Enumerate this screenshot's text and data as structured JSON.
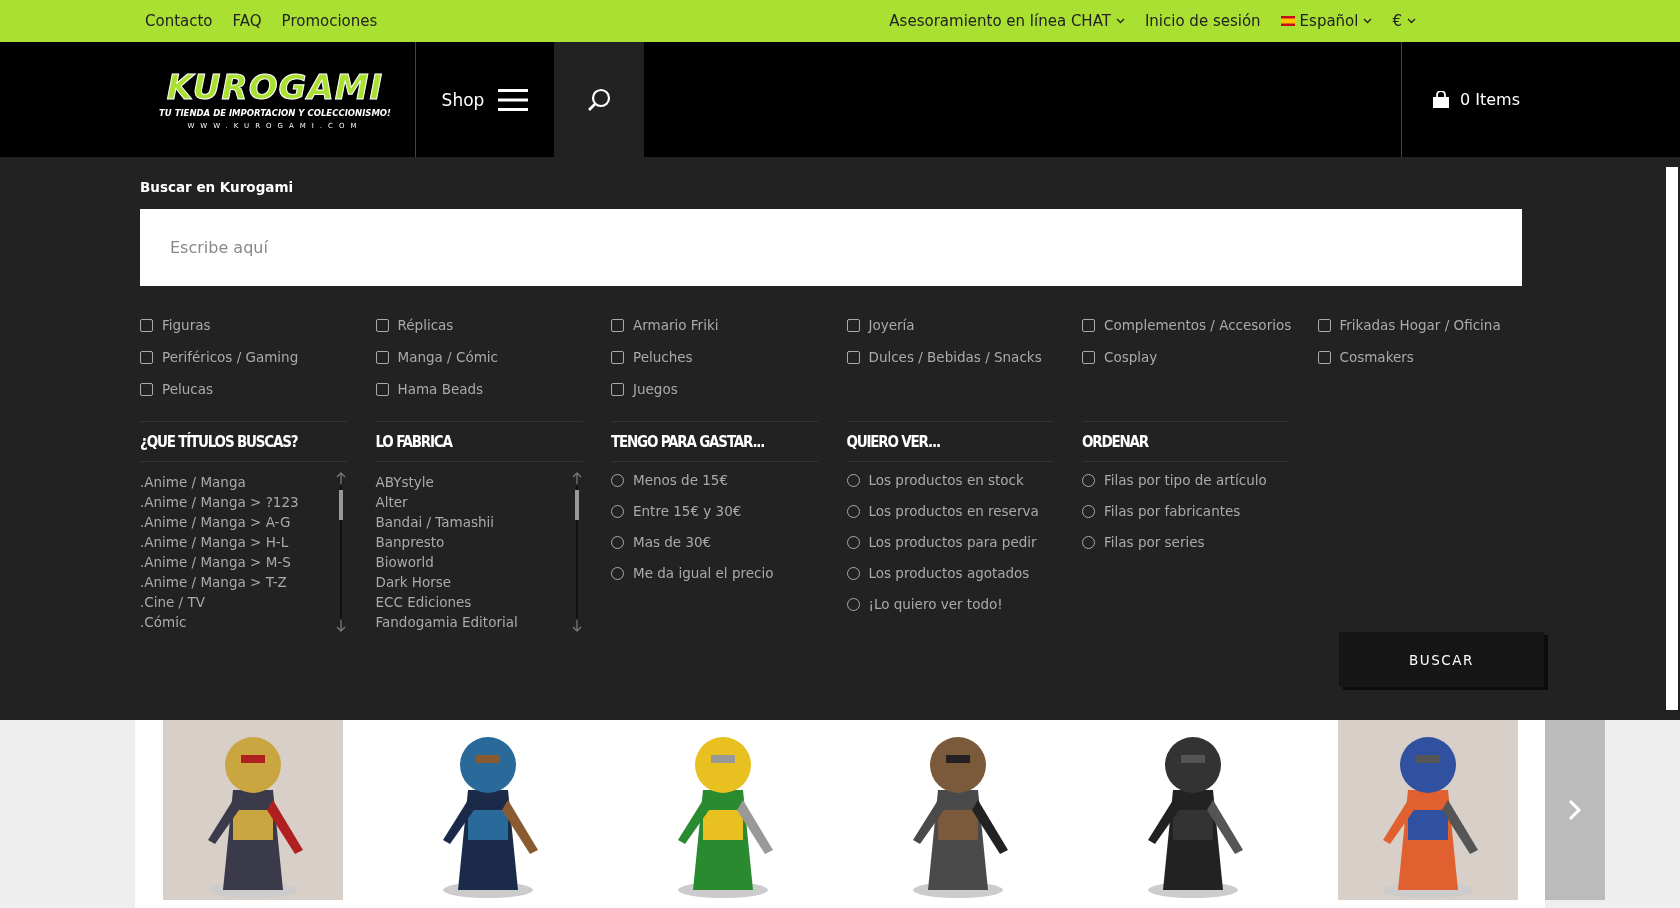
{
  "top_links": [
    "Contacto",
    "FAQ",
    "Promociones"
  ],
  "top_right": [
    {
      "kind": "dropdown",
      "label": "Asesoramiento en línea CHAT"
    },
    {
      "kind": "link",
      "label": "Inicio de sesión"
    },
    {
      "kind": "language",
      "label": "Español"
    },
    {
      "kind": "dropdown",
      "label": "€"
    }
  ],
  "logo": {
    "name": "KUROGAMI",
    "tagline": "TU TIENDA DE IMPORTACION Y COLECCIONISMO!",
    "url": "WWW.KUROGAMI.COM"
  },
  "shop_button": "Shop",
  "cart": "0 Items",
  "search": {
    "title": "Buscar en Kurogami",
    "placeholder": "Escribe aquí"
  },
  "categories": [
    {
      "label": "Figuras",
      "checked": false
    },
    {
      "label": "Réplicas",
      "checked": false
    },
    {
      "label": "Armario Friki",
      "checked": false
    },
    {
      "label": "Joyería",
      "checked": false
    },
    {
      "label": "Complementos / Accesorios",
      "checked": false
    },
    {
      "label": "Frikadas Hogar / Oficina",
      "checked": false
    },
    {
      "label": "Periféricos / Gaming",
      "checked": false
    },
    {
      "label": "Manga / Cómic",
      "checked": false
    },
    {
      "label": "Peluches",
      "checked": false
    },
    {
      "label": "Dulces / Bebidas / Snacks",
      "checked": false
    },
    {
      "label": "Cosplay",
      "checked": false
    },
    {
      "label": "Cosmakers",
      "checked": false
    },
    {
      "label": "Pelucas",
      "checked": false
    },
    {
      "label": "Hama Beads",
      "checked": false
    },
    {
      "label": "Juegos",
      "checked": false
    }
  ],
  "filters": [
    {
      "kind": "list",
      "title": "¿QUE TÍTULOS BUSCAS?",
      "items": [
        ".Anime / Manga",
        ".Anime / Manga > ?123",
        ".Anime / Manga > A-G",
        ".Anime / Manga > H-L",
        ".Anime / Manga > M-S",
        ".Anime / Manga > T-Z",
        ".Cine / TV",
        ".Cómic"
      ]
    },
    {
      "kind": "list",
      "title": "LO FABRICA",
      "items": [
        "ABYstyle",
        "Alter",
        "Bandai / Tamashii",
        "Banpresto",
        "Bioworld",
        "Dark Horse",
        "ECC Ediciones",
        "Fandogamia Editorial"
      ]
    },
    {
      "kind": "radio",
      "title": "TENGO PARA GASTAR...",
      "options": [
        {
          "label": "Menos de 15€",
          "selected": false
        },
        {
          "label": "Entre 15€ y 30€",
          "selected": false
        },
        {
          "label": "Mas de 30€",
          "selected": false
        },
        {
          "label": "Me da igual el precio",
          "selected": false
        }
      ]
    },
    {
      "kind": "radio",
      "title": "QUIERO VER...",
      "options": [
        {
          "label": "Los productos en stock",
          "selected": false
        },
        {
          "label": "Los productos en reserva",
          "selected": false
        },
        {
          "label": "Los productos para pedir",
          "selected": false
        },
        {
          "label": "Los productos agotados",
          "selected": false
        },
        {
          "label": "¡Lo quiero ver todo!",
          "selected": false
        }
      ]
    },
    {
      "kind": "radio",
      "title": "ORDENAR",
      "options": [
        {
          "label": "Filas por tipo de artículo",
          "selected": false
        },
        {
          "label": "Filas por fabricantes",
          "selected": false
        },
        {
          "label": "Filas por series",
          "selected": false
        }
      ]
    }
  ],
  "search_button": "BUSCAR",
  "products": [
    {
      "kind": "picture"
    },
    {
      "kind": "picture"
    },
    {
      "kind": "picture"
    },
    {
      "kind": "picture"
    },
    {
      "kind": "picture"
    },
    {
      "kind": "picture"
    }
  ]
}
